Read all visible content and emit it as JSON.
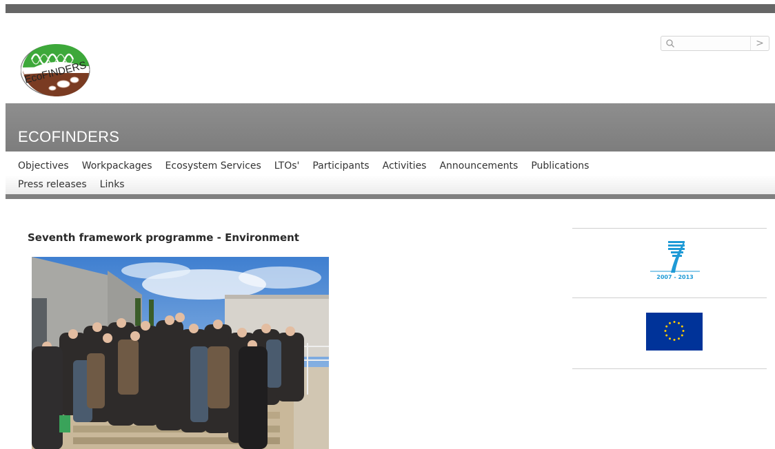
{
  "header": {
    "logo_text": "EcoFINDERS",
    "search": {
      "placeholder": "",
      "go_label": ">"
    }
  },
  "banner": {
    "title": "ECOFINDERS"
  },
  "nav": {
    "items": [
      "Objectives",
      "Workpackages",
      "Ecosystem Services",
      "LTOs'",
      "Participants",
      "Activities",
      "Announcements",
      "Publications",
      "Press releases",
      "Links"
    ]
  },
  "main": {
    "heading": "Seventh framework programme - Environment"
  },
  "sidebar": {
    "fp7_years": "2007 - 2013"
  },
  "colors": {
    "banner": "#888888",
    "fp7_blue": "#1e9ad6",
    "eu_blue": "#003399",
    "eu_star": "#ffcc00",
    "logo_green": "#3da83a",
    "logo_brown": "#7a3b22"
  }
}
